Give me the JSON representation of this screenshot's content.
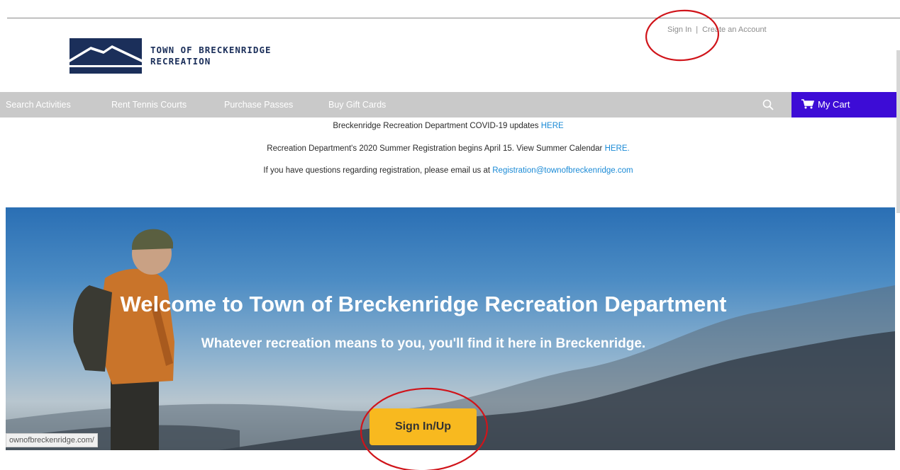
{
  "header": {
    "brand_line1": "TOWN OF BRECKENRIDGE",
    "brand_line2": "RECREATION",
    "sign_in": "Sign In",
    "separator": "|",
    "create_account": "Create an Account"
  },
  "nav": {
    "items": [
      "Search Activities",
      "Rent Tennis Courts",
      "Purchase Passes",
      "Buy Gift Cards"
    ],
    "cart_label": "My Cart"
  },
  "notices": [
    {
      "text": "Breckenridge Recreation Department COVID-19 updates ",
      "link": "HERE"
    },
    {
      "text": "Recreation Department's 2020 Summer Registration begins April 15. View Summer Calendar ",
      "link": "HERE."
    },
    {
      "text": "If you have questions regarding registration, please email us at ",
      "link": "Registration@townofbreckenridge.com"
    }
  ],
  "hero": {
    "title": "Welcome to Town of Breckenridge Recreation Department",
    "subtitle": "Whatever recreation means to you, you'll find it here in Breckenridge.",
    "button": "Sign In/Up"
  },
  "status_bar": {
    "url": "ownofbreckenridge.com/"
  },
  "colors": {
    "brand_navy": "#1b2f5a",
    "nav_gray": "#c9c9c9",
    "cart_purple": "#3d0cd6",
    "link_blue": "#1a8ad6",
    "button_yellow": "#f8b91f",
    "annotation_red": "#d0141a"
  },
  "icons": [
    "search-icon",
    "cart-icon"
  ]
}
